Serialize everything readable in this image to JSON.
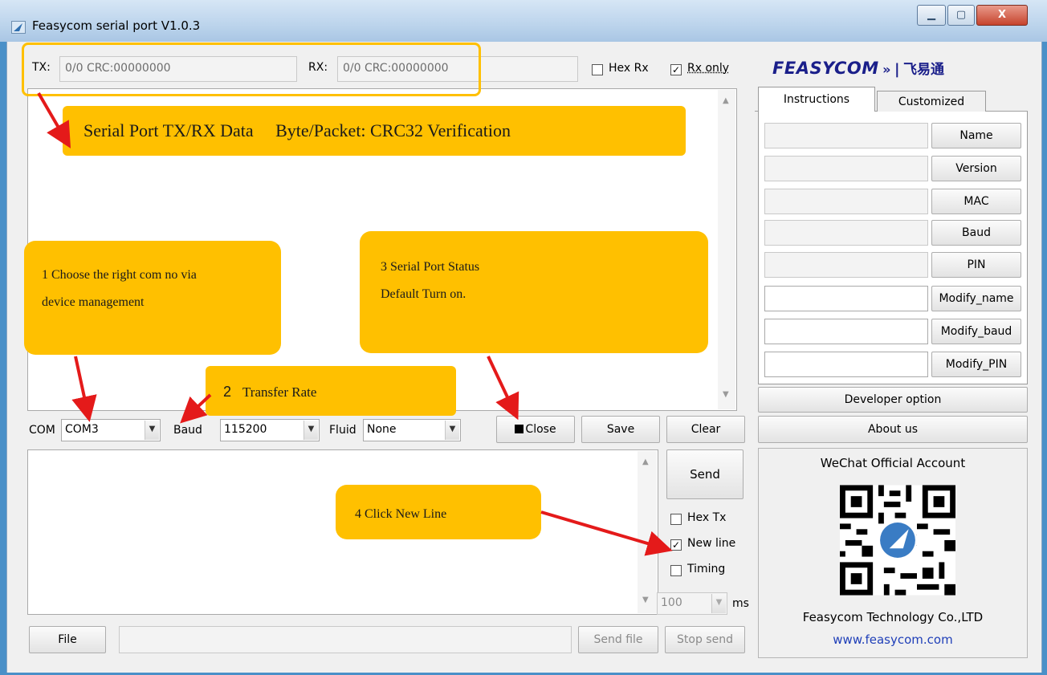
{
  "window": {
    "title": "Feasycom serial port V1.0.3",
    "minimize_glyph": "▁",
    "maximize_glyph": "▢",
    "close_glyph": "X"
  },
  "counters": {
    "tx_label": "TX:",
    "tx_value": "0/0 CRC:00000000",
    "rx_label": "RX:",
    "rx_value": "0/0 CRC:00000000",
    "hex_rx_label": "Hex Rx",
    "hex_rx_checked": false,
    "rx_only_label": "Rx only",
    "rx_only_checked": true
  },
  "brand": {
    "logo_text": "FEASYCOM",
    "logo_symbol": "»",
    "logo_divider": "|",
    "logo_cn": "飞易通",
    "accent": "#1a1f8a"
  },
  "tabs": {
    "instructions": "Instructions",
    "customized": "Customized"
  },
  "commands": [
    {
      "label": "Name"
    },
    {
      "label": "Version"
    },
    {
      "label": "MAC"
    },
    {
      "label": "Baud"
    },
    {
      "label": "PIN"
    },
    {
      "label": "Modify_name"
    },
    {
      "label": "Modify_baud"
    },
    {
      "label": "Modify_PIN"
    }
  ],
  "side_buttons": {
    "developer": "Developer option",
    "about": "About us"
  },
  "wechat": {
    "title": "WeChat Official Account",
    "company": "Feasycom Technology Co.,LTD",
    "website": "www.feasycom.com",
    "link_color": "#1f3fb8"
  },
  "port": {
    "com_label": "COM",
    "com_value": "COM3",
    "baud_label": "Baud",
    "baud_value": "115200",
    "fluid_label": "Fluid",
    "fluid_value": "None",
    "close_label": "Close",
    "save_label": "Save",
    "clear_label": "Clear"
  },
  "send_panel": {
    "send_label": "Send",
    "hex_tx_label": "Hex Tx",
    "hex_tx_checked": false,
    "new_line_label": "New line",
    "new_line_checked": true,
    "timing_label": "Timing",
    "timing_checked": false,
    "interval_value": "100",
    "interval_unit": "ms"
  },
  "file_row": {
    "file_label": "File",
    "send_file_label": "Send file",
    "stop_send_label": "Stop send"
  },
  "annotations": {
    "top": "Serial Port TX/RX Data     Byte/Packet: CRC32 Verification",
    "com_line1": "1  Choose the right com no via",
    "com_line2": "device management",
    "baud_num": "2",
    "baud_text": "Transfer Rate",
    "status_line1": "3 Serial Port Status",
    "status_line2": "Default Turn on.",
    "newline": "4 Click New Line",
    "note_color": "#ffc000",
    "arrow_color": "#e41a1a"
  },
  "scroll": {
    "up": "▲",
    "down": "▼",
    "combo": "▼"
  }
}
